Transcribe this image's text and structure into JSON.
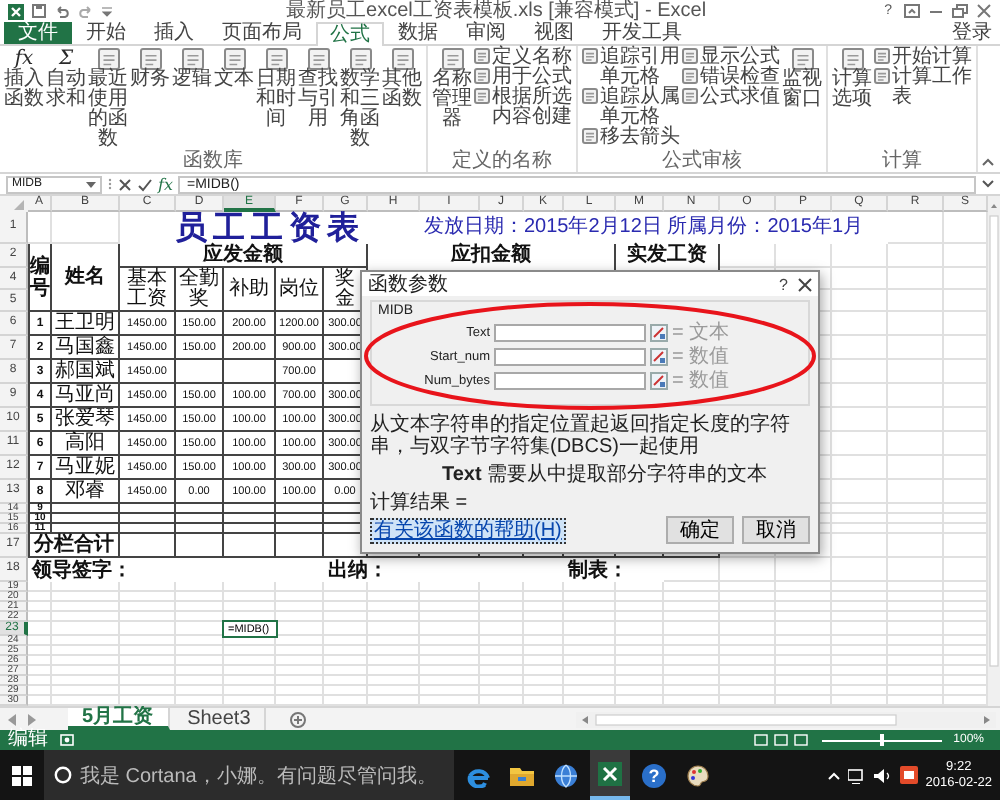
{
  "title_bar": {
    "title": "最新员工excel工资表模板.xls  [兼容模式] - Excel",
    "help": "?"
  },
  "ribbon": {
    "tabs": [
      {
        "label": "文件",
        "kind": "file",
        "selected": false
      },
      {
        "label": "开始",
        "kind": "tab",
        "selected": false
      },
      {
        "label": "插入",
        "kind": "tab",
        "selected": false
      },
      {
        "label": "页面布局",
        "kind": "tab",
        "selected": false
      },
      {
        "label": "公式",
        "kind": "tab",
        "selected": true
      },
      {
        "label": "数据",
        "kind": "tab",
        "selected": false
      },
      {
        "label": "审阅",
        "kind": "tab",
        "selected": false
      },
      {
        "label": "视图",
        "kind": "tab",
        "selected": false
      },
      {
        "label": "开发工具",
        "kind": "tab",
        "selected": false
      }
    ],
    "account": "登录",
    "groups": [
      {
        "label": "函数库",
        "items": [
          {
            "kind": "large",
            "label": "插入函数",
            "glyph": "fx"
          },
          {
            "kind": "large",
            "label": "自动求和",
            "glyph": "Σ"
          },
          {
            "kind": "large",
            "label": "最近使用的函数"
          },
          {
            "kind": "large",
            "label": "财务"
          },
          {
            "kind": "large",
            "label": "逻辑"
          },
          {
            "kind": "large",
            "label": "文本"
          },
          {
            "kind": "large",
            "label": "日期和时间"
          },
          {
            "kind": "large",
            "label": "查找与引用"
          },
          {
            "kind": "large",
            "label": "数学和三角函数"
          },
          {
            "kind": "large",
            "label": "其他函数"
          }
        ]
      },
      {
        "label": "定义的名称",
        "items": [
          {
            "kind": "large",
            "label": "名称管理器"
          },
          {
            "kind": "stack",
            "items": [
              "定义名称",
              "用于公式",
              "根据所选内容创建"
            ]
          }
        ]
      },
      {
        "label": "公式审核",
        "items": [
          {
            "kind": "stack",
            "items": [
              "追踪引用单元格",
              "追踪从属单元格",
              "移去箭头"
            ]
          },
          {
            "kind": "stack",
            "items": [
              "显示公式",
              "错误检查",
              "公式求值"
            ]
          },
          {
            "kind": "large",
            "label": "监视窗口"
          }
        ]
      },
      {
        "label": "计算",
        "items": [
          {
            "kind": "large",
            "label": "计算选项"
          },
          {
            "kind": "stack",
            "items": [
              "开始计算",
              "计算工作表"
            ]
          }
        ]
      }
    ]
  },
  "formula_bar": {
    "name_box": "MIDB",
    "fx": "fx",
    "formula": "=MIDB()"
  },
  "sheet": {
    "columns": [
      {
        "label": "A",
        "selected": false
      },
      {
        "label": "B",
        "selected": false
      },
      {
        "label": "C",
        "selected": false
      },
      {
        "label": "D",
        "selected": false
      },
      {
        "label": "E",
        "selected": true
      },
      {
        "label": "F",
        "selected": false
      },
      {
        "label": "G",
        "selected": false
      },
      {
        "label": "H",
        "selected": false
      },
      {
        "label": "I",
        "selected": false
      },
      {
        "label": "J",
        "selected": false
      },
      {
        "label": "K",
        "selected": false
      },
      {
        "label": "L",
        "selected": false
      },
      {
        "label": "M",
        "selected": false
      },
      {
        "label": "N",
        "selected": false
      },
      {
        "label": "O",
        "selected": false
      },
      {
        "label": "P",
        "selected": false
      },
      {
        "label": "Q",
        "selected": false
      },
      {
        "label": "R",
        "selected": false
      },
      {
        "label": "S",
        "selected": false
      }
    ],
    "rows": [
      {
        "label": "1",
        "kind": "title",
        "selected": false,
        "cells": [
          "",
          "",
          "员工工资表",
          "",
          "",
          "",
          "",
          "",
          "发放日期：2015年2月12日  所属月份：2015年1月",
          "",
          "",
          "",
          "",
          "",
          "",
          "",
          ""
        ]
      },
      {
        "label": "2",
        "kind": "header",
        "selected": false,
        "cells": [
          "编号",
          "姓名",
          "应发金额",
          "",
          "",
          "",
          "",
          "应扣金额",
          "",
          "",
          "",
          "",
          "实发工资",
          ""
        ]
      },
      {
        "label": "4",
        "kind": "subhead",
        "selected": false,
        "cells": [
          "",
          "",
          "基本工资",
          "全勤奖",
          "补助",
          "岗位",
          "奖金"
        ]
      },
      {
        "label": "5",
        "kind": "subhead2",
        "selected": false
      },
      {
        "label": "6",
        "kind": "data",
        "selected": false,
        "cells": [
          "1",
          "王卫明",
          "1450.00",
          "150.00",
          "200.00",
          "1200.00",
          "300.00"
        ]
      },
      {
        "label": "7",
        "kind": "data",
        "selected": false,
        "cells": [
          "2",
          "马国鑫",
          "1450.00",
          "150.00",
          "200.00",
          "900.00",
          "300.00"
        ]
      },
      {
        "label": "8",
        "kind": "data",
        "selected": false,
        "cells": [
          "3",
          "郝国斌",
          "1450.00",
          "",
          "",
          "700.00"
        ]
      },
      {
        "label": "9",
        "kind": "data",
        "selected": false,
        "cells": [
          "4",
          "马亚尚",
          "1450.00",
          "150.00",
          "100.00",
          "700.00",
          "300.00"
        ]
      },
      {
        "label": "10",
        "kind": "data",
        "selected": false,
        "cells": [
          "5",
          "张爱琴",
          "1450.00",
          "150.00",
          "100.00",
          "100.00",
          "300.00"
        ]
      },
      {
        "label": "11",
        "kind": "data",
        "selected": false,
        "cells": [
          "6",
          "高阳",
          "1450.00",
          "150.00",
          "100.00",
          "100.00",
          "300.00"
        ]
      },
      {
        "label": "12",
        "kind": "data",
        "selected": false,
        "cells": [
          "7",
          "马亚妮",
          "1450.00",
          "150.00",
          "100.00",
          "300.00",
          "300.00"
        ]
      },
      {
        "label": "13",
        "kind": "data",
        "selected": false,
        "cells": [
          "8",
          "邓睿",
          "1450.00",
          "0.00",
          "100.00",
          "100.00",
          "0.00"
        ]
      },
      {
        "label": "14",
        "kind": "blank",
        "selected": false,
        "cells": [
          "9"
        ]
      },
      {
        "label": "15",
        "kind": "blank",
        "selected": false,
        "cells": [
          "10"
        ]
      },
      {
        "label": "16",
        "kind": "blank",
        "selected": false,
        "cells": [
          "11"
        ]
      },
      {
        "label": "17",
        "kind": "total",
        "selected": false,
        "cells": [
          "分栏合计",
          ""
        ]
      },
      {
        "label": "18",
        "kind": "sign",
        "selected": false,
        "cells": [
          "领导签字：",
          "",
          "",
          "",
          "",
          "",
          "出纳：",
          "",
          "",
          "",
          "",
          "制表：",
          ""
        ]
      },
      {
        "label": "19",
        "kind": "empty",
        "selected": false
      },
      {
        "label": "20",
        "kind": "empty",
        "selected": false
      },
      {
        "label": "21",
        "kind": "empty",
        "selected": false
      },
      {
        "label": "22",
        "kind": "empty",
        "selected": false
      },
      {
        "label": "23",
        "kind": "empty",
        "selected": true,
        "cells": [
          "",
          "",
          "",
          "",
          "=MIDB()"
        ]
      },
      {
        "label": "24",
        "kind": "empty",
        "selected": false
      },
      {
        "label": "25",
        "kind": "empty",
        "selected": false
      },
      {
        "label": "26",
        "kind": "empty",
        "selected": false
      },
      {
        "label": "27",
        "kind": "empty",
        "selected": false
      },
      {
        "label": "28",
        "kind": "empty",
        "selected": false
      },
      {
        "label": "29",
        "kind": "empty",
        "selected": false
      },
      {
        "label": "30",
        "kind": "empty",
        "selected": false
      }
    ]
  },
  "dialog": {
    "title": "函数参数",
    "help": "?",
    "function": "MIDB",
    "args": [
      {
        "name": "Text",
        "hint": "= 文本"
      },
      {
        "name": "Start_num",
        "hint": "= 数值"
      },
      {
        "name": "Num_bytes",
        "hint": "= 数值"
      }
    ],
    "description": "从文本字符串的指定位置起返回指定长度的字符串，与双字节字符集(DBCS)一起使用",
    "arg_help": "**Text**  需要从中提取部分字符串的文本",
    "result": "计算结果 =",
    "help_link": "有关该函数的帮助(H)",
    "buttons": [
      "确定",
      "取消"
    ]
  },
  "sheet_tabs": [
    {
      "label": "5月工资",
      "selected": true
    },
    {
      "label": "Sheet3",
      "selected": false
    }
  ],
  "status_bar": {
    "mode": "编辑",
    "zoom_slider": {
      "level": 0.5
    },
    "zoom": "100%"
  },
  "taskbar": {
    "search": "我是 Cortana，小娜。有问题尽管问我。",
    "apps": [
      {
        "kind": "edge",
        "selected": false
      },
      {
        "kind": "folder",
        "selected": false
      },
      {
        "kind": "globe",
        "selected": false
      },
      {
        "kind": "excel",
        "selected": true
      },
      {
        "kind": "help",
        "glyph": "?",
        "selected": false
      },
      {
        "kind": "paint",
        "selected": false
      }
    ],
    "time": "9:22",
    "date": "2016-02-22"
  }
}
